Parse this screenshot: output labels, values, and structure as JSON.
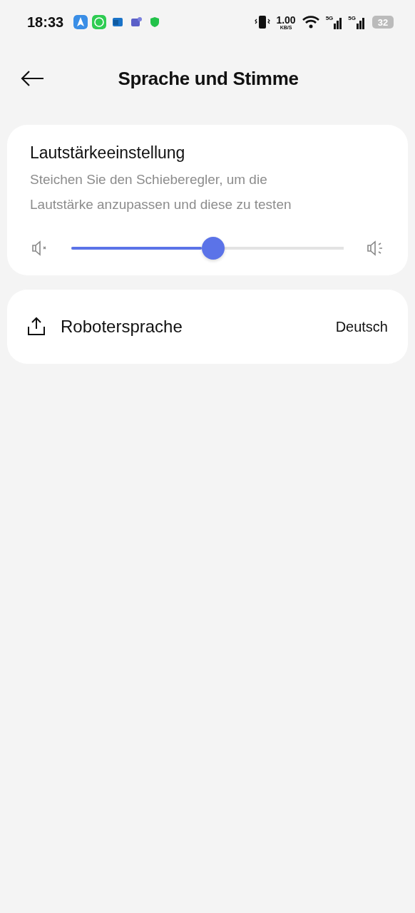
{
  "status_bar": {
    "time": "18:33",
    "speed_value": "1.00",
    "speed_unit": "KB/S",
    "network_labels": [
      "5G",
      "5G"
    ],
    "battery": "32"
  },
  "header": {
    "title": "Sprache und Stimme"
  },
  "volume_card": {
    "title": "Lautstärkeeinstellung",
    "description": "Steichen Sie den Schieberegler, um die Lautstärke anzupassen und diese zu testen",
    "level": 0.52
  },
  "language_row": {
    "label": "Robotersprache",
    "value": "Deutsch"
  }
}
